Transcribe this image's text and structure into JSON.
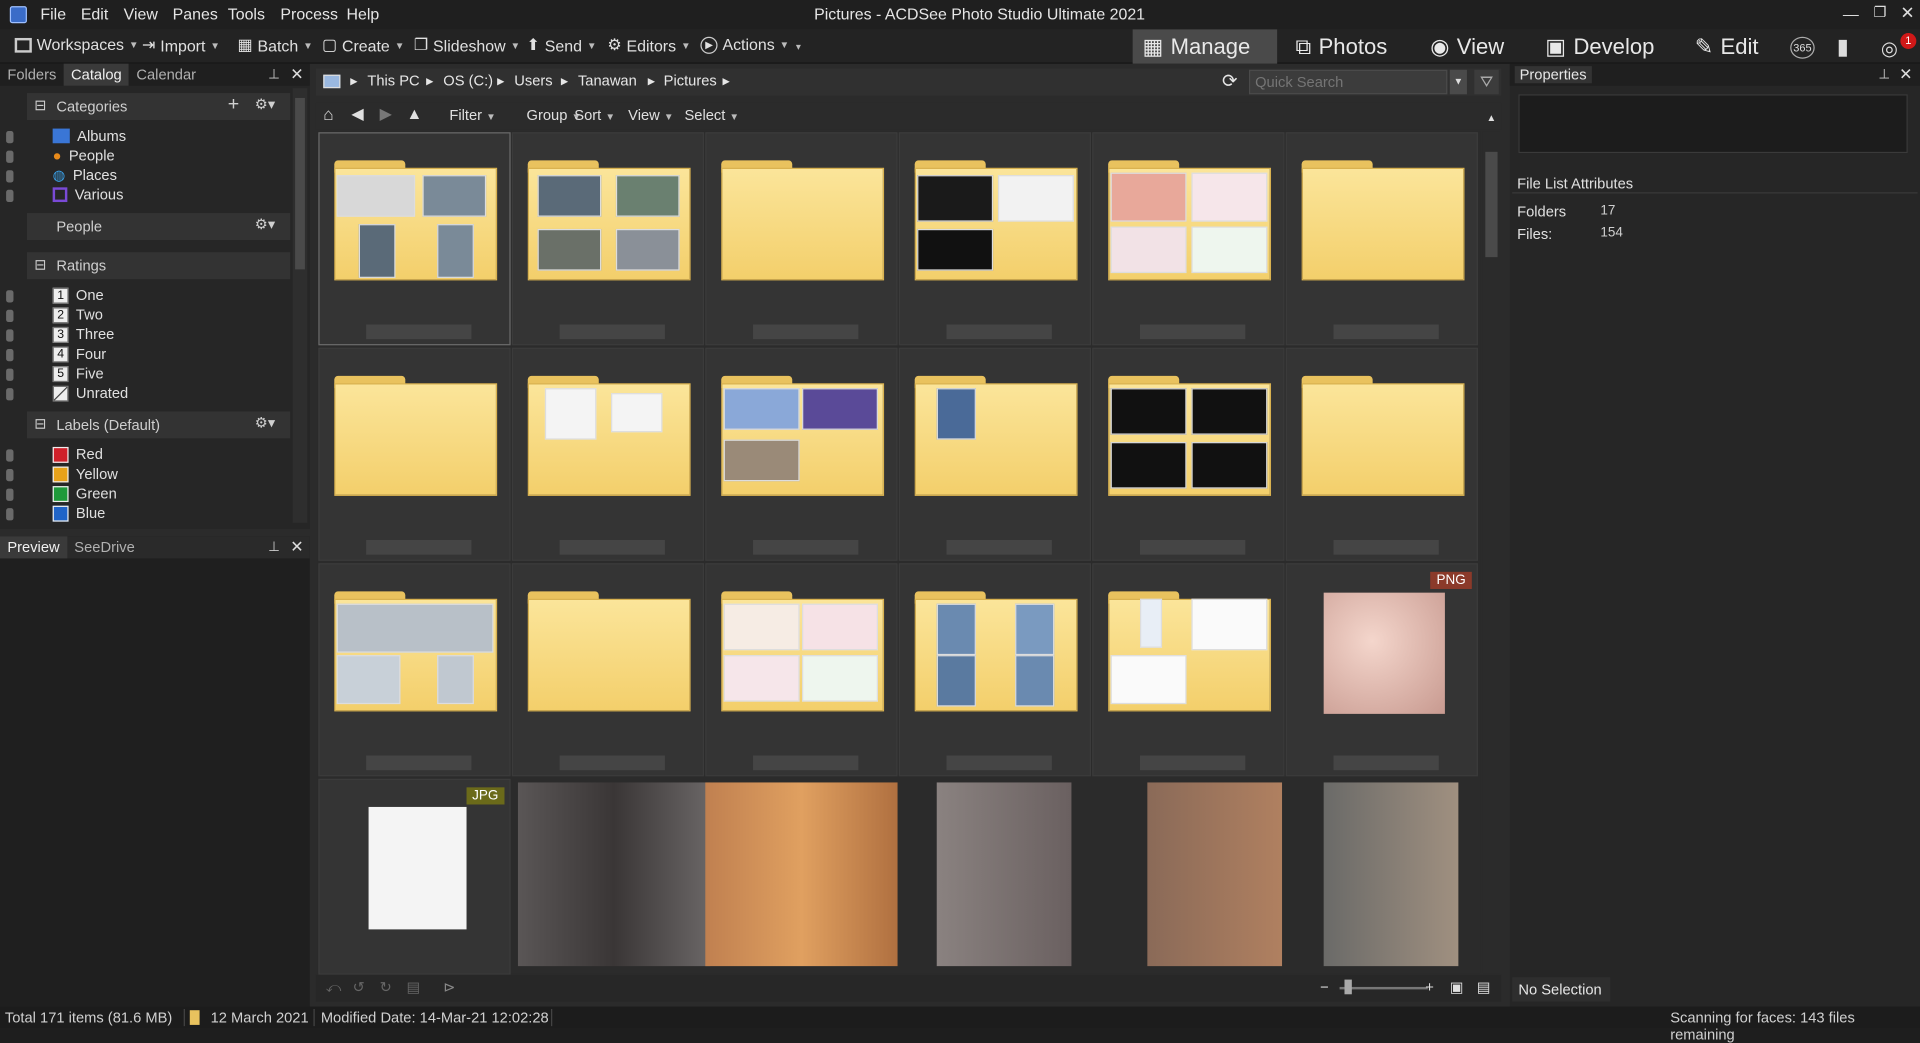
{
  "window": {
    "title": "Pictures - ACDSee Photo Studio Ultimate 2021"
  },
  "menu": [
    "File",
    "Edit",
    "View",
    "Panes",
    "Tools",
    "Process",
    "Help"
  ],
  "toolbar": {
    "workspaces": "Workspaces",
    "import": "Import",
    "batch": "Batch",
    "create": "Create",
    "slideshow": "Slideshow",
    "send": "Send",
    "editors": "Editors",
    "actions": "Actions"
  },
  "modes": {
    "manage": "Manage",
    "photos": "Photos",
    "view": "View",
    "develop": "Develop",
    "edit": "Edit",
    "badge_365": "365",
    "notification_count": "1"
  },
  "left_tabs": [
    "Folders",
    "Catalog",
    "Calendar"
  ],
  "catalog": {
    "categories_header": "Categories",
    "categories": [
      "Albums",
      "People",
      "Places",
      "Various"
    ],
    "people_header": "People",
    "ratings_header": "Ratings",
    "ratings": [
      {
        "num": "1",
        "label": "One"
      },
      {
        "num": "2",
        "label": "Two"
      },
      {
        "num": "3",
        "label": "Three"
      },
      {
        "num": "4",
        "label": "Four"
      },
      {
        "num": "5",
        "label": "Five"
      },
      {
        "num": "",
        "label": "Unrated"
      }
    ],
    "labels_header": "Labels (Default)",
    "labels": [
      {
        "label": "Red",
        "color": "#d0202a"
      },
      {
        "label": "Yellow",
        "color": "#e8a21a"
      },
      {
        "label": "Green",
        "color": "#1e9a3a"
      },
      {
        "label": "Blue",
        "color": "#1f64c8"
      }
    ]
  },
  "preview_tabs": [
    "Preview",
    "SeeDrive"
  ],
  "breadcrumb": [
    "This PC",
    "OS (C:)",
    "Users",
    "Tanawan",
    "Pictures"
  ],
  "search": {
    "placeholder": "Quick Search"
  },
  "browser_bar": [
    "Filter",
    "Group",
    "Sort",
    "View",
    "Select"
  ],
  "badges": {
    "png": "PNG",
    "jpg": "JPG"
  },
  "properties": {
    "title": "Properties",
    "section": "File List Attributes",
    "folders_label": "Folders",
    "folders_value": "17",
    "files_label": "Files:",
    "files_value": "154",
    "selection": "No Selection"
  },
  "status": {
    "total": "Total 171 items  (81.6 MB)",
    "date": "12 March 2021",
    "modified": "Modified Date: 14-Mar-21 12:02:28",
    "scanning": "Scanning for faces: 143 files remaining"
  },
  "colors": {
    "accent_manage": "#4a4a4a",
    "folder": "#f3cf6b",
    "png_badge": "#8b3a2a",
    "jpg_badge": "#6b6a1a"
  }
}
